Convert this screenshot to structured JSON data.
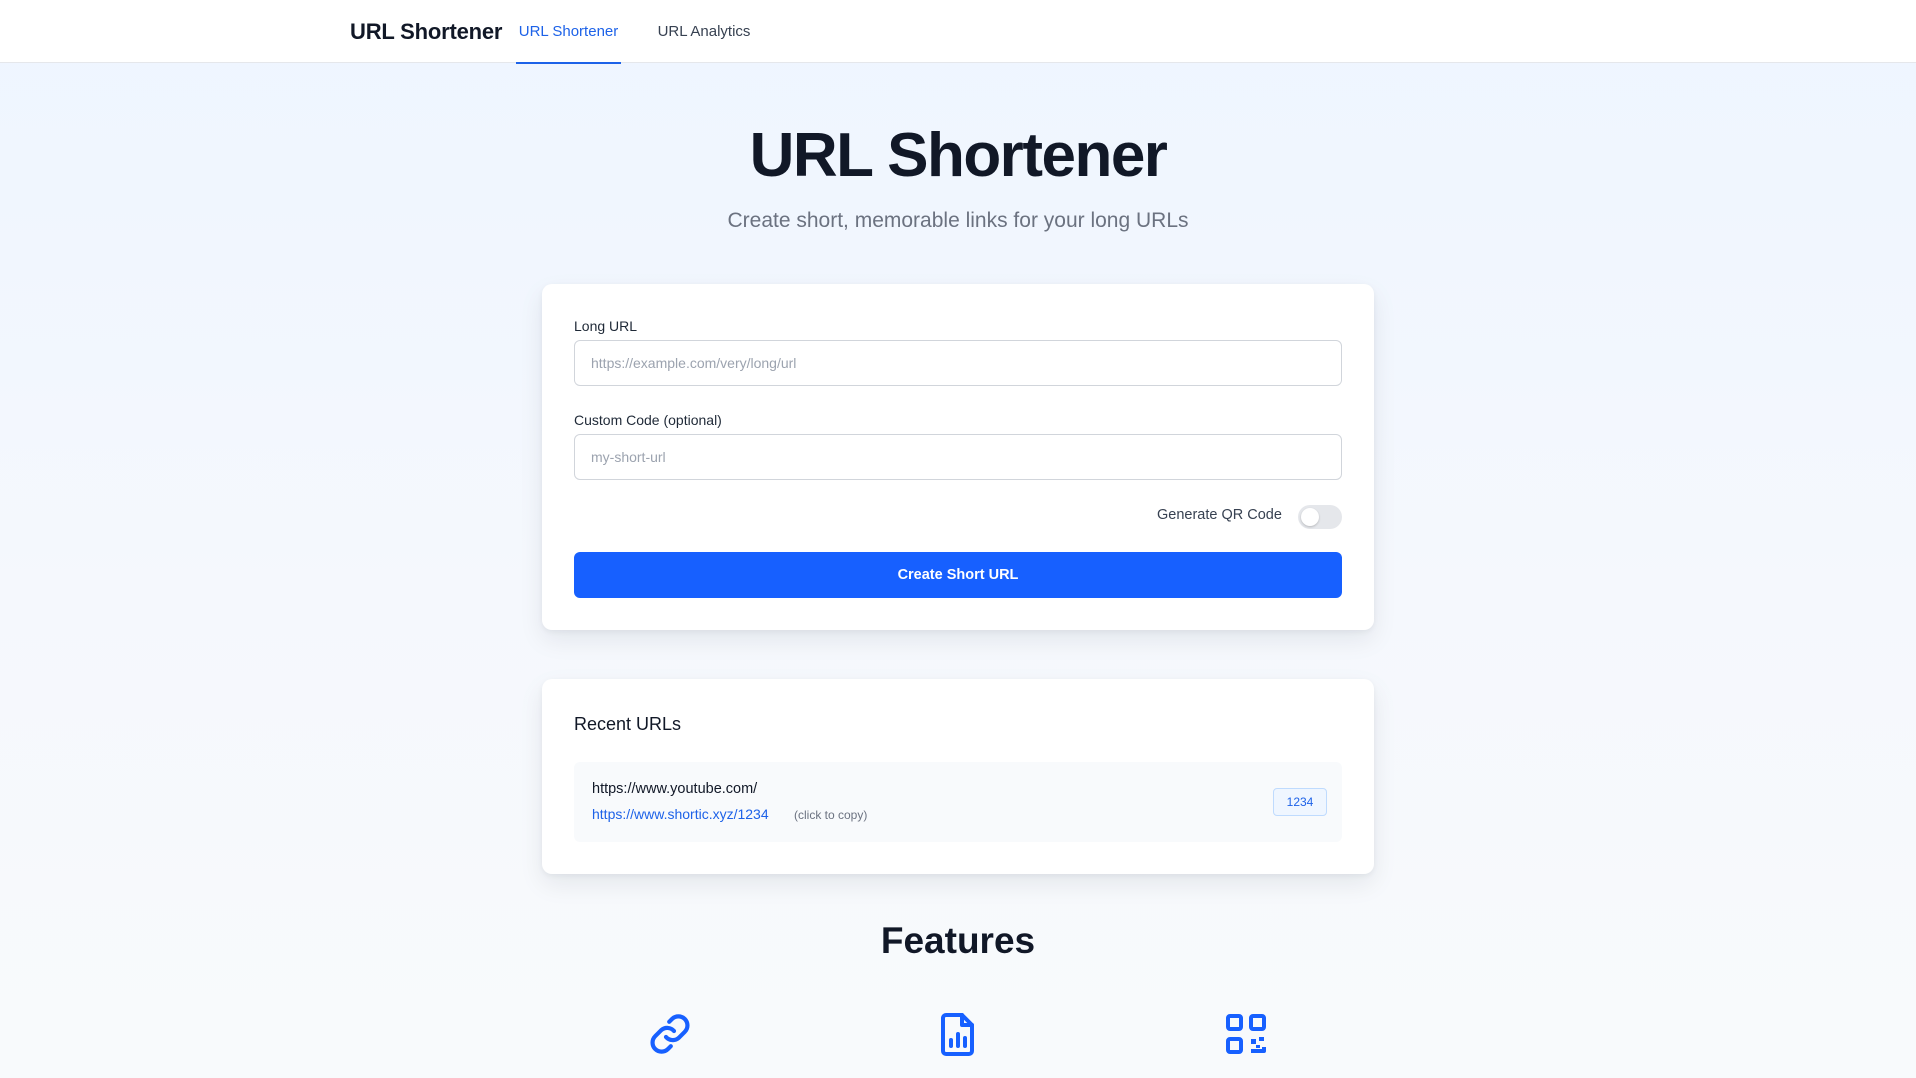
{
  "nav": {
    "brand": "URL Shortener",
    "tabs": [
      {
        "label": "URL Shortener",
        "active": true
      },
      {
        "label": "URL Analytics",
        "active": false
      }
    ]
  },
  "hero": {
    "title": "URL Shortener",
    "subtitle": "Create short, memorable links for your long URLs"
  },
  "form": {
    "long_url_label": "Long URL",
    "long_url_placeholder": "https://example.com/very/long/url",
    "long_url_value": "",
    "custom_code_label": "Custom Code (optional)",
    "custom_code_placeholder": "my-short-url",
    "custom_code_value": "",
    "qr_label": "Generate QR Code",
    "qr_enabled": false,
    "submit_label": "Create Short URL"
  },
  "recent": {
    "title": "Recent URLs",
    "items": [
      {
        "long_url": "https://www.youtube.com/",
        "short_url": "https://www.shortic.xyz/1234",
        "copy_hint": "(click to copy)",
        "code": "1234"
      }
    ]
  },
  "features": {
    "title": "Features",
    "icons": [
      "link-icon",
      "report-chart-icon",
      "qr-code-icon"
    ]
  },
  "colors": {
    "accent": "#1760ff",
    "link": "#1d62e8"
  }
}
